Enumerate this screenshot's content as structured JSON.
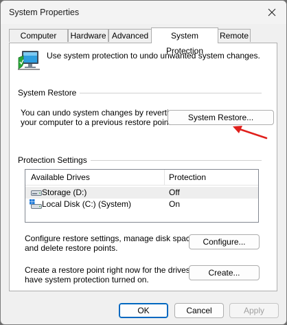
{
  "window": {
    "title": "System Properties"
  },
  "tabs": [
    {
      "label": "Computer Name"
    },
    {
      "label": "Hardware"
    },
    {
      "label": "Advanced"
    },
    {
      "label": "System Protection"
    },
    {
      "label": "Remote"
    }
  ],
  "intro": {
    "text": "Use system protection to undo unwanted system changes."
  },
  "system_restore": {
    "section_label": "System Restore",
    "description_line1": "You can undo system changes by reverting",
    "description_line2": "your computer to a previous restore point.",
    "button_label": "System Restore..."
  },
  "protection": {
    "section_label": "Protection Settings",
    "columns": [
      "Available Drives",
      "Protection"
    ],
    "drives": [
      {
        "name": "Storage (D:)",
        "protection": "Off",
        "icon": "drive-icon"
      },
      {
        "name": "Local Disk (C:) (System)",
        "protection": "On",
        "icon": "system-drive-icon"
      }
    ],
    "configure_line1": "Configure restore settings, manage disk space,",
    "configure_line2": "and delete restore points.",
    "configure_button": "Configure...",
    "create_line1": "Create a restore point right now for the drives that",
    "create_line2": "have system protection turned on.",
    "create_button": "Create..."
  },
  "footer": {
    "ok": "OK",
    "cancel": "Cancel",
    "apply": "Apply"
  },
  "colors": {
    "accent": "#0067c0",
    "annotation_arrow": "#e0201c"
  }
}
